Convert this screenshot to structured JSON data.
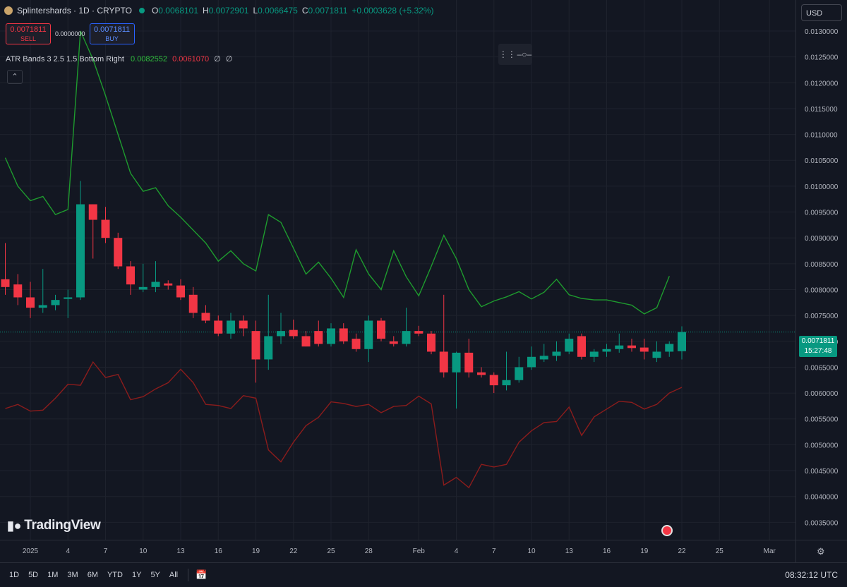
{
  "header": {
    "symbol": "Splintershards · 1D · CRYPTO",
    "ohlc": [
      {
        "k": "O",
        "v": "0.0068101"
      },
      {
        "k": "H",
        "v": "0.0072901"
      },
      {
        "k": "L",
        "v": "0.0066475"
      },
      {
        "k": "C",
        "v": "0.0071811"
      }
    ],
    "change": "+0.0003628 (+5.32%)",
    "currency": "USD"
  },
  "trade": {
    "sell_price": "0.0071811",
    "sell_label": "SELL",
    "spread": "0.0000000",
    "buy_price": "0.0071811",
    "buy_label": "BUY"
  },
  "indicator": {
    "name": "ATR Bands 3 2.5 1.5 Bottom Right",
    "upper": "0.0082552",
    "lower": "0.0061070",
    "extra1": "∅",
    "extra2": "∅"
  },
  "last_price": {
    "price": "0.0071811",
    "countdown": "15:27:48"
  },
  "logo_text": "TradingView",
  "timeframes": [
    "1D",
    "5D",
    "1M",
    "3M",
    "6M",
    "YTD",
    "1Y",
    "5Y",
    "All"
  ],
  "clock": "08:32:12 UTC",
  "colors": {
    "up": "#089981",
    "down": "#f23645",
    "upper_band": "#1e9b2e",
    "lower_band": "#8b1c1c",
    "bg": "#131722",
    "grid": "#1e222d"
  },
  "icons": {
    "collapse": "chevron-up-icon",
    "calendar": "calendar-range-icon",
    "settings": "gear-icon",
    "event": "us-flag-icon"
  },
  "chart_data": {
    "type": "candlestick",
    "y_axis": {
      "min": 0.0032,
      "max": 0.0133,
      "ticks": [
        "0.0130000",
        "0.0125000",
        "0.0120000",
        "0.0115000",
        "0.0110000",
        "0.0105000",
        "0.0100000",
        "0.0095000",
        "0.0090000",
        "0.0085000",
        "0.0080000",
        "0.0075000",
        "0.0070000",
        "0.0065000",
        "0.0060000",
        "0.0055000",
        "0.0050000",
        "0.0045000",
        "0.0040000",
        "0.0035000"
      ]
    },
    "x_axis": {
      "ticks": [
        {
          "label": "2025",
          "i": 2
        },
        {
          "label": "4",
          "i": 5
        },
        {
          "label": "7",
          "i": 8
        },
        {
          "label": "10",
          "i": 11
        },
        {
          "label": "13",
          "i": 14
        },
        {
          "label": "16",
          "i": 17
        },
        {
          "label": "19",
          "i": 20
        },
        {
          "label": "22",
          "i": 23
        },
        {
          "label": "25",
          "i": 26
        },
        {
          "label": "28",
          "i": 29
        },
        {
          "label": "Feb",
          "i": 33
        },
        {
          "label": "4",
          "i": 36
        },
        {
          "label": "7",
          "i": 39
        },
        {
          "label": "10",
          "i": 42
        },
        {
          "label": "13",
          "i": 45
        },
        {
          "label": "16",
          "i": 48
        },
        {
          "label": "19",
          "i": 51
        },
        {
          "label": "22",
          "i": 54
        },
        {
          "label": "25",
          "i": 57
        },
        {
          "label": "Mar",
          "i": 61
        }
      ]
    },
    "candles": [
      {
        "o": 0.0082,
        "h": 0.0089,
        "l": 0.0079,
        "c": 0.00805
      },
      {
        "o": 0.0081,
        "h": 0.0083,
        "l": 0.0077,
        "c": 0.00785
      },
      {
        "o": 0.00785,
        "h": 0.00815,
        "l": 0.00745,
        "c": 0.00765
      },
      {
        "o": 0.00765,
        "h": 0.0084,
        "l": 0.00755,
        "c": 0.0077
      },
      {
        "o": 0.0077,
        "h": 0.0079,
        "l": 0.0076,
        "c": 0.0078
      },
      {
        "o": 0.00782,
        "h": 0.008,
        "l": 0.00745,
        "c": 0.00785
      },
      {
        "o": 0.00785,
        "h": 0.0101,
        "l": 0.0078,
        "c": 0.00965
      },
      {
        "o": 0.00965,
        "h": 0.00965,
        "l": 0.0086,
        "c": 0.00935
      },
      {
        "o": 0.00935,
        "h": 0.0096,
        "l": 0.0089,
        "c": 0.009
      },
      {
        "o": 0.009,
        "h": 0.0091,
        "l": 0.0084,
        "c": 0.00845
      },
      {
        "o": 0.00845,
        "h": 0.00855,
        "l": 0.0079,
        "c": 0.0081
      },
      {
        "o": 0.008,
        "h": 0.0085,
        "l": 0.00795,
        "c": 0.00805
      },
      {
        "o": 0.00805,
        "h": 0.00855,
        "l": 0.00795,
        "c": 0.00815
      },
      {
        "o": 0.00812,
        "h": 0.00818,
        "l": 0.008,
        "c": 0.00808
      },
      {
        "o": 0.00808,
        "h": 0.0082,
        "l": 0.0078,
        "c": 0.00785
      },
      {
        "o": 0.0079,
        "h": 0.00805,
        "l": 0.00745,
        "c": 0.00755
      },
      {
        "o": 0.00755,
        "h": 0.0077,
        "l": 0.00735,
        "c": 0.0074
      },
      {
        "o": 0.0074,
        "h": 0.0075,
        "l": 0.0071,
        "c": 0.00715
      },
      {
        "o": 0.00715,
        "h": 0.00755,
        "l": 0.00705,
        "c": 0.0074
      },
      {
        "o": 0.0074,
        "h": 0.0075,
        "l": 0.0071,
        "c": 0.00725
      },
      {
        "o": 0.0072,
        "h": 0.0074,
        "l": 0.0062,
        "c": 0.00665
      },
      {
        "o": 0.00665,
        "h": 0.0079,
        "l": 0.00645,
        "c": 0.0071
      },
      {
        "o": 0.0071,
        "h": 0.00755,
        "l": 0.00695,
        "c": 0.0072
      },
      {
        "o": 0.00722,
        "h": 0.00742,
        "l": 0.00705,
        "c": 0.0071
      },
      {
        "o": 0.0071,
        "h": 0.0072,
        "l": 0.0069,
        "c": 0.0069
      },
      {
        "o": 0.0072,
        "h": 0.0074,
        "l": 0.0069,
        "c": 0.00695
      },
      {
        "o": 0.00695,
        "h": 0.00735,
        "l": 0.0069,
        "c": 0.00725
      },
      {
        "o": 0.00725,
        "h": 0.00735,
        "l": 0.00695,
        "c": 0.007
      },
      {
        "o": 0.00705,
        "h": 0.00715,
        "l": 0.0068,
        "c": 0.00685
      },
      {
        "o": 0.00685,
        "h": 0.0075,
        "l": 0.0066,
        "c": 0.0074
      },
      {
        "o": 0.0074,
        "h": 0.00745,
        "l": 0.007,
        "c": 0.00705
      },
      {
        "o": 0.007,
        "h": 0.0071,
        "l": 0.0069,
        "c": 0.00695
      },
      {
        "o": 0.00695,
        "h": 0.00765,
        "l": 0.0069,
        "c": 0.0072
      },
      {
        "o": 0.0072,
        "h": 0.0073,
        "l": 0.0071,
        "c": 0.00715
      },
      {
        "o": 0.00715,
        "h": 0.0072,
        "l": 0.00675,
        "c": 0.0068
      },
      {
        "o": 0.0068,
        "h": 0.0079,
        "l": 0.0063,
        "c": 0.0064
      },
      {
        "o": 0.0064,
        "h": 0.0068,
        "l": 0.0057,
        "c": 0.00678
      },
      {
        "o": 0.00678,
        "h": 0.00705,
        "l": 0.0063,
        "c": 0.0064
      },
      {
        "o": 0.0064,
        "h": 0.0065,
        "l": 0.0063,
        "c": 0.00635
      },
      {
        "o": 0.00635,
        "h": 0.0064,
        "l": 0.006,
        "c": 0.00615
      },
      {
        "o": 0.00615,
        "h": 0.0068,
        "l": 0.00605,
        "c": 0.00625
      },
      {
        "o": 0.00625,
        "h": 0.0067,
        "l": 0.0062,
        "c": 0.0065
      },
      {
        "o": 0.0065,
        "h": 0.0069,
        "l": 0.00645,
        "c": 0.0067
      },
      {
        "o": 0.00665,
        "h": 0.00695,
        "l": 0.0066,
        "c": 0.00672
      },
      {
        "o": 0.00672,
        "h": 0.007,
        "l": 0.00662,
        "c": 0.0068
      },
      {
        "o": 0.0068,
        "h": 0.00715,
        "l": 0.00675,
        "c": 0.00705
      },
      {
        "o": 0.0071,
        "h": 0.00715,
        "l": 0.00665,
        "c": 0.0067
      },
      {
        "o": 0.0067,
        "h": 0.00685,
        "l": 0.0066,
        "c": 0.0068
      },
      {
        "o": 0.0068,
        "h": 0.00695,
        "l": 0.0067,
        "c": 0.00685
      },
      {
        "o": 0.00685,
        "h": 0.00715,
        "l": 0.00678,
        "c": 0.00692
      },
      {
        "o": 0.00692,
        "h": 0.00705,
        "l": 0.0068,
        "c": 0.00687
      },
      {
        "o": 0.00688,
        "h": 0.00705,
        "l": 0.00665,
        "c": 0.0068
      },
      {
        "o": 0.00668,
        "h": 0.007,
        "l": 0.0066,
        "c": 0.0068
      },
      {
        "o": 0.0068,
        "h": 0.007,
        "l": 0.0067,
        "c": 0.00695
      },
      {
        "o": 0.00681,
        "h": 0.00729,
        "l": 0.00665,
        "c": 0.00718
      }
    ],
    "upper_band": [
      0.01055,
      0.01,
      0.00972,
      0.0098,
      0.00945,
      0.00955,
      0.013,
      0.01245,
      0.01175,
      0.011,
      0.01025,
      0.0099,
      0.00997,
      0.00962,
      0.0094,
      0.00915,
      0.0089,
      0.00855,
      0.00875,
      0.0085,
      0.00836,
      0.00945,
      0.0093,
      0.0088,
      0.0083,
      0.00853,
      0.00822,
      0.00785,
      0.00877,
      0.0083,
      0.008,
      0.00875,
      0.00825,
      0.00788,
      0.00845,
      0.00905,
      0.0086,
      0.008,
      0.00767,
      0.00778,
      0.00786,
      0.00796,
      0.00782,
      0.00795,
      0.0082,
      0.0079,
      0.00783,
      0.0078,
      0.0078,
      0.00775,
      0.0077,
      0.00753,
      0.00765,
      0.00826
    ],
    "lower_band": [
      0.0057,
      0.00578,
      0.00565,
      0.00567,
      0.0059,
      0.00617,
      0.00615,
      0.0066,
      0.0063,
      0.00636,
      0.00587,
      0.00593,
      0.00608,
      0.0062,
      0.00646,
      0.0062,
      0.00578,
      0.00576,
      0.0057,
      0.00595,
      0.0059,
      0.0049,
      0.00467,
      0.00505,
      0.00537,
      0.00553,
      0.00583,
      0.0058,
      0.00574,
      0.00578,
      0.00562,
      0.00574,
      0.00576,
      0.00594,
      0.00579,
      0.00422,
      0.00437,
      0.00417,
      0.00462,
      0.00457,
      0.00462,
      0.00505,
      0.00527,
      0.00543,
      0.00545,
      0.00573,
      0.00518,
      0.00554,
      0.00569,
      0.00584,
      0.00582,
      0.00569,
      0.00578,
      0.006,
      0.00611
    ]
  }
}
